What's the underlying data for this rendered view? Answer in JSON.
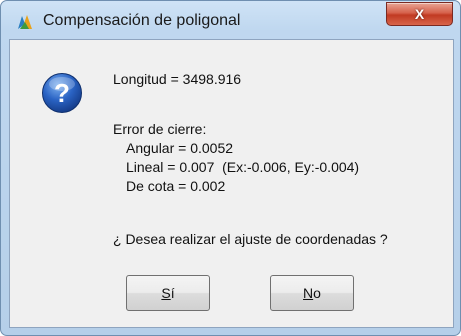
{
  "window": {
    "title": "Compensación de poligonal",
    "close_label": "X"
  },
  "message": {
    "longitud": "Longitud = 3498.916",
    "error_heading": "Error de cierre:",
    "angular": "Angular = 0.0052",
    "lineal": "Lineal = 0.007  (Ex:-0.006, Ey:-0.004)",
    "cota": "De cota = 0.002",
    "question": "¿ Desea realizar el ajuste de coordenadas ?"
  },
  "buttons": {
    "yes_mnemonic": "S",
    "yes_rest": "í",
    "no_mnemonic": "N",
    "no_rest": "o"
  },
  "icons": {
    "app": "app-logo-icon",
    "question": "question-icon"
  }
}
